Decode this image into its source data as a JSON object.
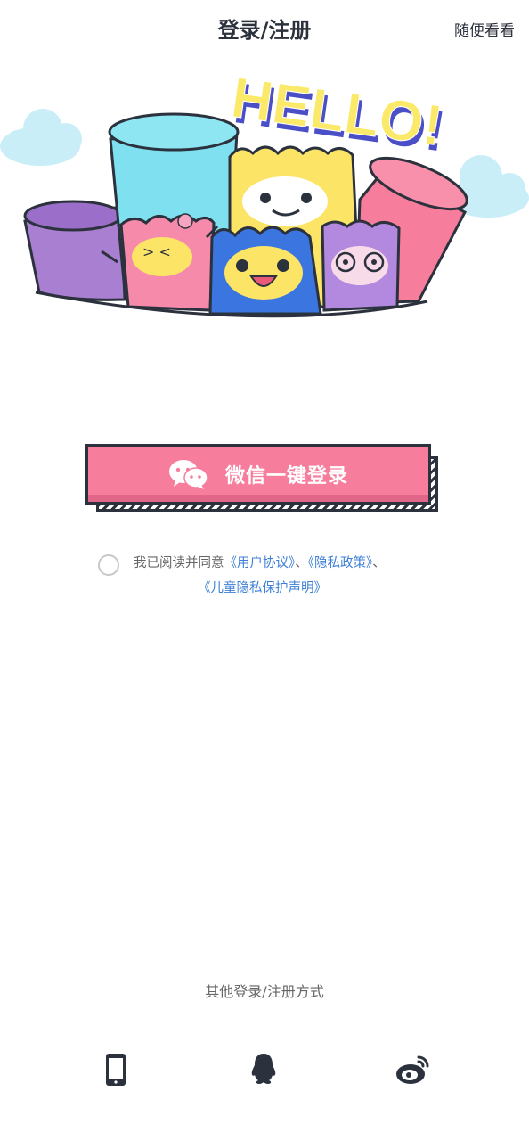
{
  "header": {
    "title": "登录/注册",
    "skip_label": "随便看看"
  },
  "hero": {
    "text": "HELLO!"
  },
  "wechat_button": {
    "label": "微信一键登录",
    "icon": "wechat-icon",
    "color": "#f77d9d"
  },
  "agreement": {
    "prefix": "我已阅读并同意",
    "link1": "《用户协议》",
    "sep1": "、",
    "link2": "《隐私政策》",
    "sep2": "、",
    "link3": "《儿童隐私保护声明》",
    "link_color": "#3d7fd6"
  },
  "other_login": {
    "label": "其他登录/注册方式",
    "methods": [
      {
        "name": "phone",
        "icon": "phone-icon"
      },
      {
        "name": "qq",
        "icon": "qq-icon"
      },
      {
        "name": "weibo",
        "icon": "weibo-icon"
      }
    ]
  }
}
